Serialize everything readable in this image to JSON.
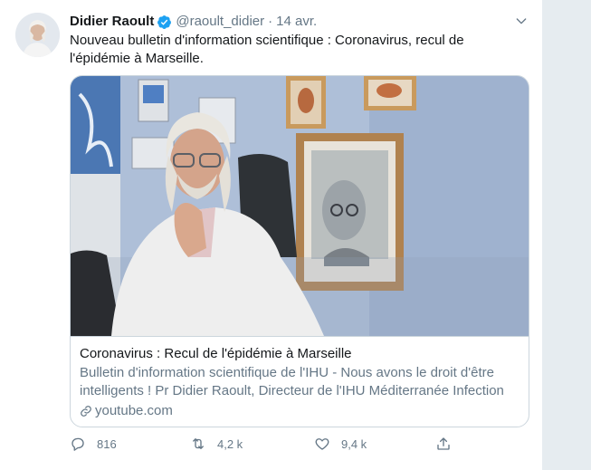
{
  "tweet": {
    "author_name": "Didier Raoult",
    "handle": "@raoult_didier",
    "separator": "·",
    "time": "14 avr.",
    "text_line1": "Nouveau bulletin d'information scientifique : Coronavirus, recul de",
    "text_line2": "l'épidémie à Marseille."
  },
  "link_card": {
    "title": "Coronavirus : Recul de l'épidémie à Marseille",
    "description_line1": "Bulletin d'information scientifique de l'IHU - Nous avons le droit d'être",
    "description_line2": "intelligents ! Pr Didier Raoult, Directeur de l'IHU Méditerranée Infection",
    "domain": "youtube.com"
  },
  "actions": {
    "replies": "816",
    "retweets": "4,2 k",
    "likes": "9,4 k"
  },
  "icons": {
    "verified": "verified-badge-icon",
    "caret": "chevron-down-icon",
    "link": "link-icon",
    "reply": "reply-icon",
    "retweet": "retweet-icon",
    "like": "heart-icon",
    "share": "share-icon"
  },
  "colors": {
    "accent": "#1da1f2",
    "secondary_text": "#657786",
    "border": "#ccd6dd"
  }
}
